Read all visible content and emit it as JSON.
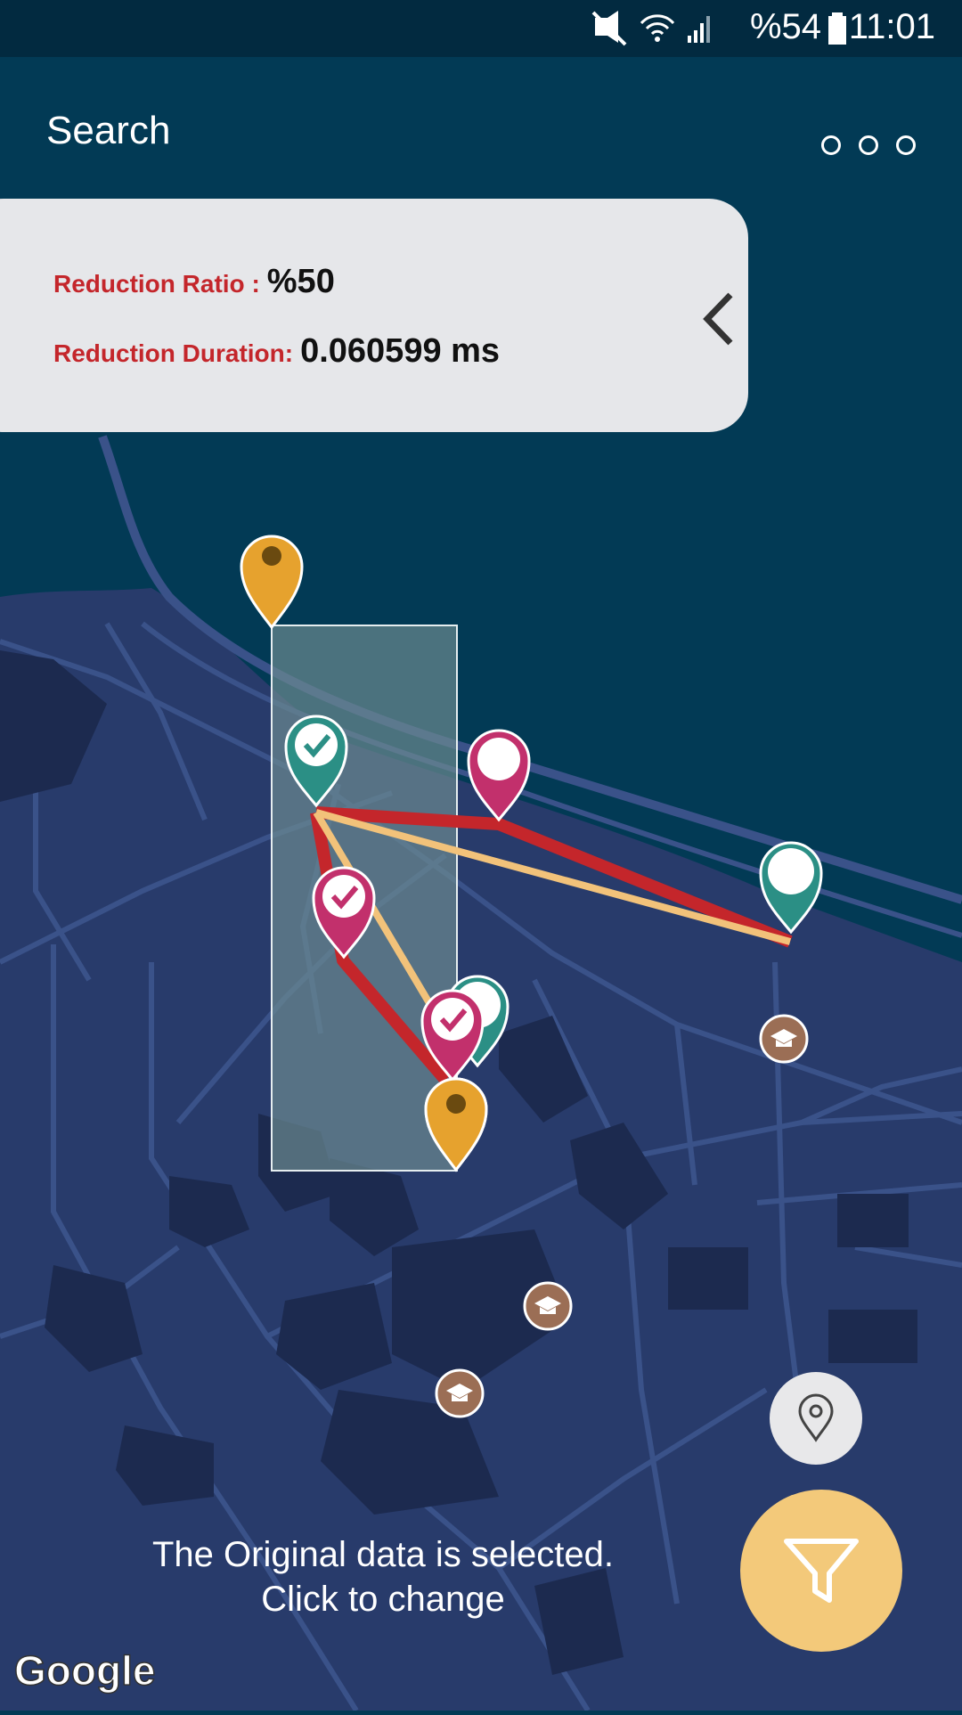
{
  "status_bar": {
    "battery": "%54",
    "time": "11:01",
    "icons": [
      "mute-vibrate-icon",
      "wifi-icon",
      "signal-icon",
      "battery-icon"
    ]
  },
  "header": {
    "title": "Search",
    "menu_icon": "more-options-icon"
  },
  "info_card": {
    "ratio_label": "Reduction Ratio :",
    "ratio_value": "%50",
    "duration_label": "Reduction Duration:",
    "duration_value": "0.060599 ms",
    "collapse_icon": "chevron-left-icon"
  },
  "map": {
    "attribution": "Google",
    "colors": {
      "water": "#023a55",
      "land": "#283b6b",
      "roads": "#3a5289",
      "buildings": "#1c2a4f",
      "original_route": "#c4262b",
      "reduced_route": "#f2c27a",
      "selection": "#6b8a90"
    },
    "markers": [
      "start-pin",
      "end-pin",
      "checked-pin-teal",
      "checked-pin-magenta",
      "pin-magenta",
      "pin-teal",
      "school-icon"
    ]
  },
  "bottom_note": {
    "line1": "The Original data is selected.",
    "line2": "Click to change"
  },
  "buttons": {
    "location_icon": "location-pin-icon",
    "filter_icon": "filter-icon"
  },
  "colors": {
    "accent": "#f3c97a",
    "app_bar": "#023a55",
    "status_bar": "#022a40",
    "label_red": "#c4262b"
  }
}
